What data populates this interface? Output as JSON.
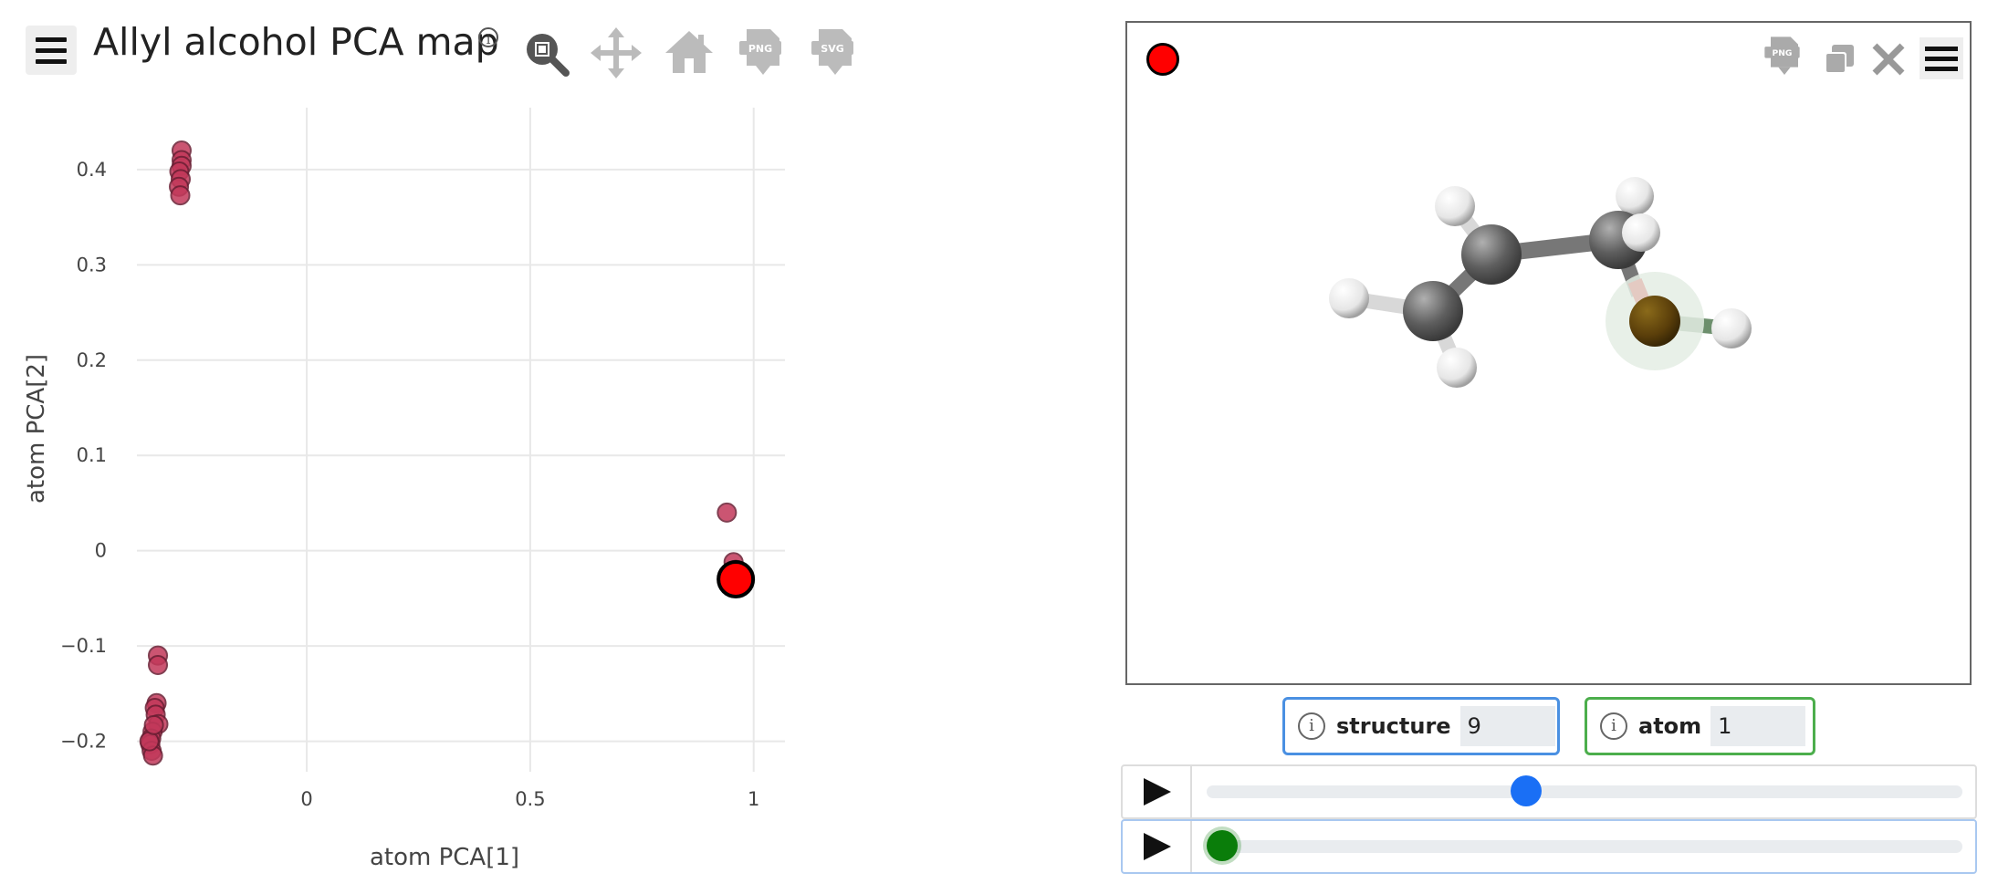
{
  "map": {
    "title": "Allyl alcohol PCA map",
    "info_symbol": "i",
    "toolbar": [
      "zoom-icon",
      "pan-icon",
      "home-icon",
      "png-download-icon",
      "svg-download-icon"
    ]
  },
  "chart_data": {
    "type": "scatter",
    "xlabel": "atom PCA[1]",
    "ylabel": "atom PCA[2]",
    "xlim": [
      -0.38,
      1.07
    ],
    "ylim": [
      -0.232,
      0.465
    ],
    "x_ticks": [
      0,
      0.5,
      1
    ],
    "x_tick_labels": [
      "0",
      "0.5",
      "1"
    ],
    "y_ticks": [
      -0.2,
      -0.1,
      0,
      0.1,
      0.2,
      0.3,
      0.4
    ],
    "y_tick_labels": [
      "−0.2",
      "−0.1",
      "0",
      "0.1",
      "0.2",
      "0.3",
      "0.4"
    ],
    "grid": true,
    "point_color": "#c2385a",
    "points": [
      {
        "x": -0.28,
        "y": 0.42
      },
      {
        "x": -0.28,
        "y": 0.41
      },
      {
        "x": -0.28,
        "y": 0.404
      },
      {
        "x": -0.285,
        "y": 0.398
      },
      {
        "x": -0.282,
        "y": 0.39
      },
      {
        "x": -0.286,
        "y": 0.382
      },
      {
        "x": -0.283,
        "y": 0.373
      },
      {
        "x": 0.94,
        "y": 0.04
      },
      {
        "x": 0.955,
        "y": -0.012
      },
      {
        "x": 0.96,
        "y": -0.02
      },
      {
        "x": -0.333,
        "y": -0.11
      },
      {
        "x": -0.333,
        "y": -0.12
      },
      {
        "x": -0.336,
        "y": -0.16
      },
      {
        "x": -0.34,
        "y": -0.165
      },
      {
        "x": -0.338,
        "y": -0.172
      },
      {
        "x": -0.332,
        "y": -0.182
      },
      {
        "x": -0.345,
        "y": -0.19
      },
      {
        "x": -0.348,
        "y": -0.197
      },
      {
        "x": -0.35,
        "y": -0.203
      },
      {
        "x": -0.347,
        "y": -0.21
      },
      {
        "x": -0.344,
        "y": -0.215
      },
      {
        "x": -0.352,
        "y": -0.2
      },
      {
        "x": -0.342,
        "y": -0.183
      }
    ],
    "selected_point": {
      "x": 0.96,
      "y": -0.03,
      "color": "#ff0000"
    }
  },
  "viewer": {
    "indicator_color": "#ff0000",
    "toolbar": [
      "png-download-icon",
      "copy-icon",
      "close-icon",
      "menu-icon"
    ]
  },
  "structure": {
    "label": "structure",
    "value": "9",
    "border_color": "#4a90e2"
  },
  "atom": {
    "label": "atom",
    "value": "1",
    "border_color": "#4cae4c"
  },
  "players": [
    {
      "name": "structure-player",
      "level": 0.42,
      "knob_color": "#1a6ff5"
    },
    {
      "name": "atom-player",
      "level": 0.0,
      "knob_color": "#0a7d0a"
    }
  ]
}
